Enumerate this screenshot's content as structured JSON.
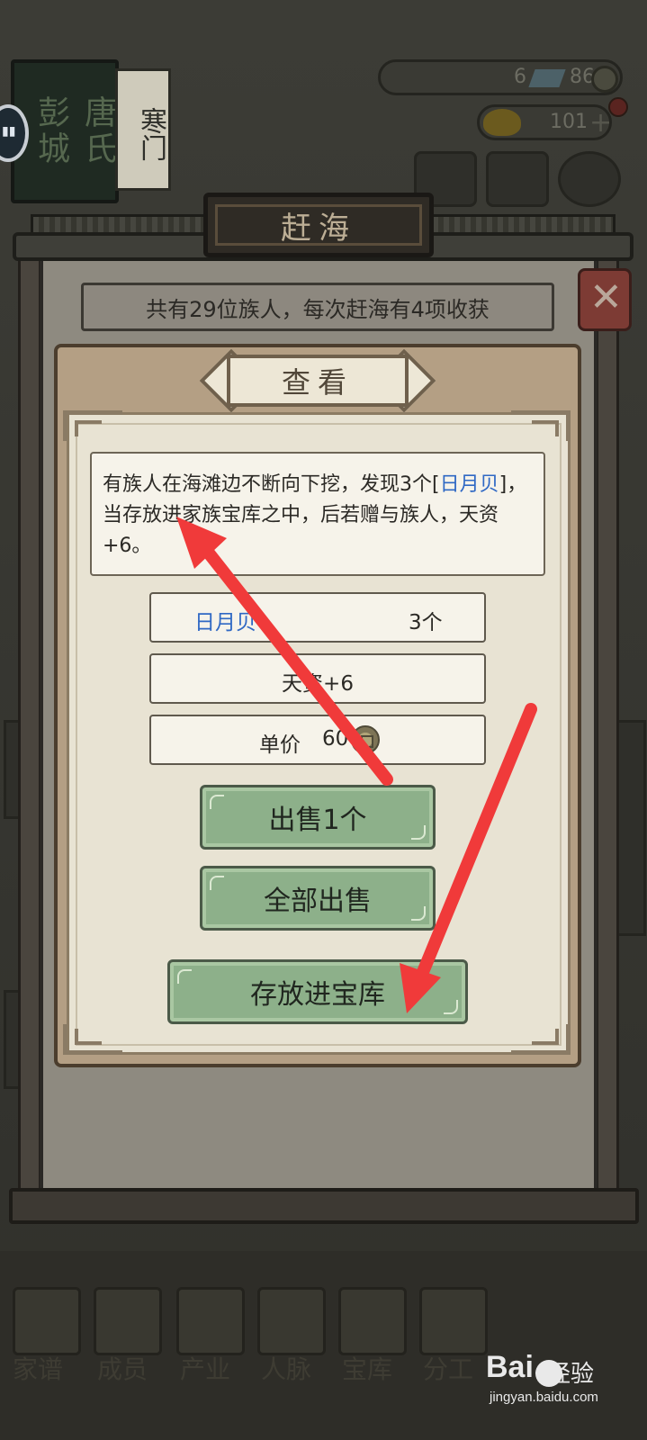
{
  "background": {
    "clan_sign_left": "彭城",
    "clan_sign_right": "唐氏",
    "rank_plate": "寒门",
    "gems": "6",
    "coins": "86",
    "gold": "101"
  },
  "window": {
    "title": "赶海",
    "info": "共有29位族人，每次赶海有4项收获",
    "close_icon": "close-x-icon"
  },
  "popup": {
    "title": "查看",
    "description_before": "有族人在海滩边不断向下挖，发现3个[",
    "description_item": "日月贝",
    "description_after": "]，当存放进家族宝库之中，后若赠与族人，天资+6。",
    "item_name": "日月贝",
    "item_count": "3个",
    "effect": "天资+6",
    "price_label": "单价",
    "price_value": "60",
    "buttons": {
      "sell_one": "出售1个",
      "sell_all": "全部出售",
      "store": "存放进宝库"
    }
  },
  "bottom_nav": [
    "家谱",
    "成员",
    "产业",
    "人脉",
    "宝库",
    "分工"
  ],
  "watermark": {
    "brand_left": "Bai",
    "brand_right": "经验",
    "url": "jingyan.baidu.com"
  },
  "colors": {
    "item_highlight": "#2f68c4",
    "button_green": "#8db08a",
    "annotation_arrow": "#f03a3a"
  }
}
